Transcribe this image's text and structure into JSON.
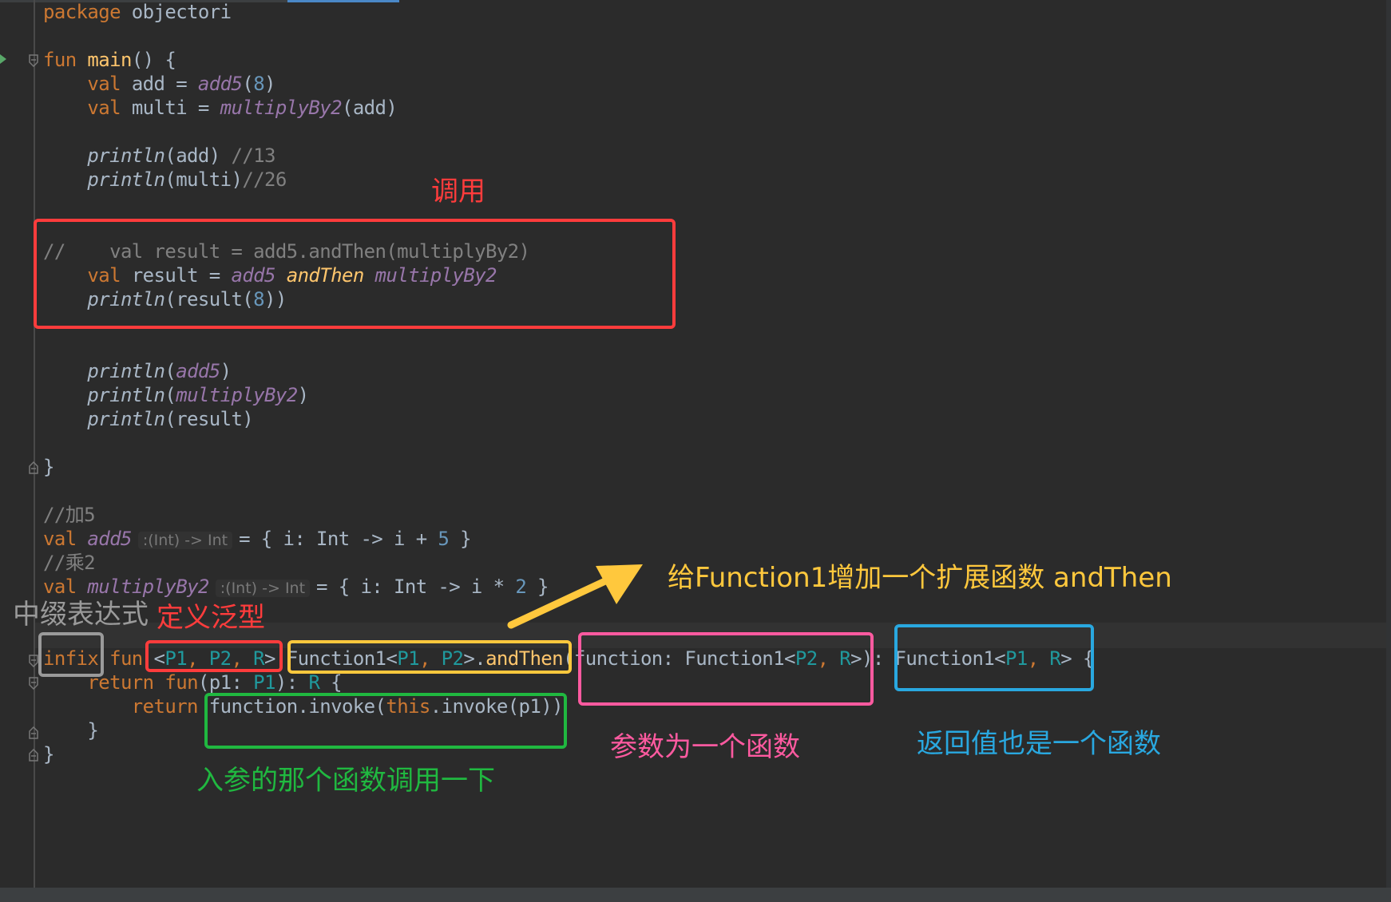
{
  "colors": {
    "background": "#2b2b2b",
    "keyword": "#cc7832",
    "function_name": "#ffc66d",
    "identifier": "#a9b7c6",
    "number": "#6897bb",
    "property": "#9876aa",
    "generic": "#20999d",
    "comment": "#808080",
    "annotation_red": "#ff3c3c",
    "annotation_yellow": "#ffc83d",
    "annotation_pink": "#ff5aa0",
    "annotation_blue": "#29a8e0",
    "annotation_green": "#20b840",
    "annotation_gray": "#9a9a9a"
  },
  "code": {
    "l1": {
      "kw": "package",
      "pkg": " objectori"
    },
    "l2": {
      "kw": "fun",
      "name": "main",
      "rest": "() {"
    },
    "l3": {
      "kw": "val",
      "a": " add = ",
      "fn": "add5",
      "b": "(",
      "num": "8",
      "c": ")"
    },
    "l4": {
      "kw": "val",
      "a": " multi = ",
      "fn": "multiplyBy2",
      "b": "(add)"
    },
    "l5": {
      "fn": "println",
      "a": "(add) ",
      "cm": "//13"
    },
    "l6": {
      "fn": "println",
      "a": "(multi)",
      "cm": "//26"
    },
    "l7": {
      "cm": "//    val result = add5.andThen(multiplyBy2)"
    },
    "l8": {
      "kw": "val",
      "a": " result = ",
      "p1": "add5",
      "inf": "andThen",
      "p2": "multiplyBy2"
    },
    "l9": {
      "fn": "println",
      "a": "(result(",
      "num": "8",
      "b": "))"
    },
    "l10": {
      "fn": "println",
      "a": "(",
      "p": "add5",
      "b": ")"
    },
    "l11": {
      "fn": "println",
      "a": "(",
      "p": "multiplyBy2",
      "b": ")"
    },
    "l12": {
      "fn": "println",
      "a": "(result)"
    },
    "l13": {
      "a": "}"
    },
    "l14": {
      "cm": "//加5"
    },
    "l15": {
      "kw": "val",
      "p": "add5",
      "hint": ":(Int) -> Int",
      "a": "= { i: Int -> i + ",
      "num": "5",
      "b": " }"
    },
    "l16": {
      "cm": "//乘2"
    },
    "l17": {
      "kw": "val",
      "p": "multiplyBy2",
      "hint": ":(Int) -> Int",
      "a": "= { i: Int -> i * ",
      "num": "2",
      "b": " }"
    },
    "l18": {
      "kw1": "infix",
      "kw2": " fun ",
      "lt": "<",
      "g1": "P1",
      "sep1": ", ",
      "g2": "P2",
      "sep2": ", ",
      "g3": "R",
      "gt": ">",
      "sp": " ",
      "fnc": "Function1<",
      "g4": "P1",
      "sep3": ", ",
      "g5": "P2",
      "rcv": ">.",
      "name": "andThen",
      "paren": "(function: Function1<",
      "g6": "P2",
      "sep4": ", ",
      "g7": "R",
      "close": ">): Function1<",
      "g8": "P1",
      "sep5": ", ",
      "g9": "R",
      "end": "> {"
    },
    "l19": {
      "kw1": "return",
      "kw2": " fun",
      "a": "(p1: ",
      "g1": "P1",
      "b": "): ",
      "g2": "R",
      "c": " {"
    },
    "l20": {
      "kw": "return",
      "a": " function.invoke(",
      "kw2": "this",
      "b": ".invoke(p1))"
    },
    "l21": {
      "a": "}"
    },
    "l22": {
      "a": "}"
    }
  },
  "annotations": {
    "call": "调用",
    "infix_expr": "中缀表达式",
    "define_generic": "定义泛型",
    "extend": "给Function1增加一个扩展函数 andThen",
    "param_is_function": "参数为一个函数",
    "return_is_function": "返回值也是一个函数",
    "invoke_input": "入参的那个函数调用一下"
  }
}
